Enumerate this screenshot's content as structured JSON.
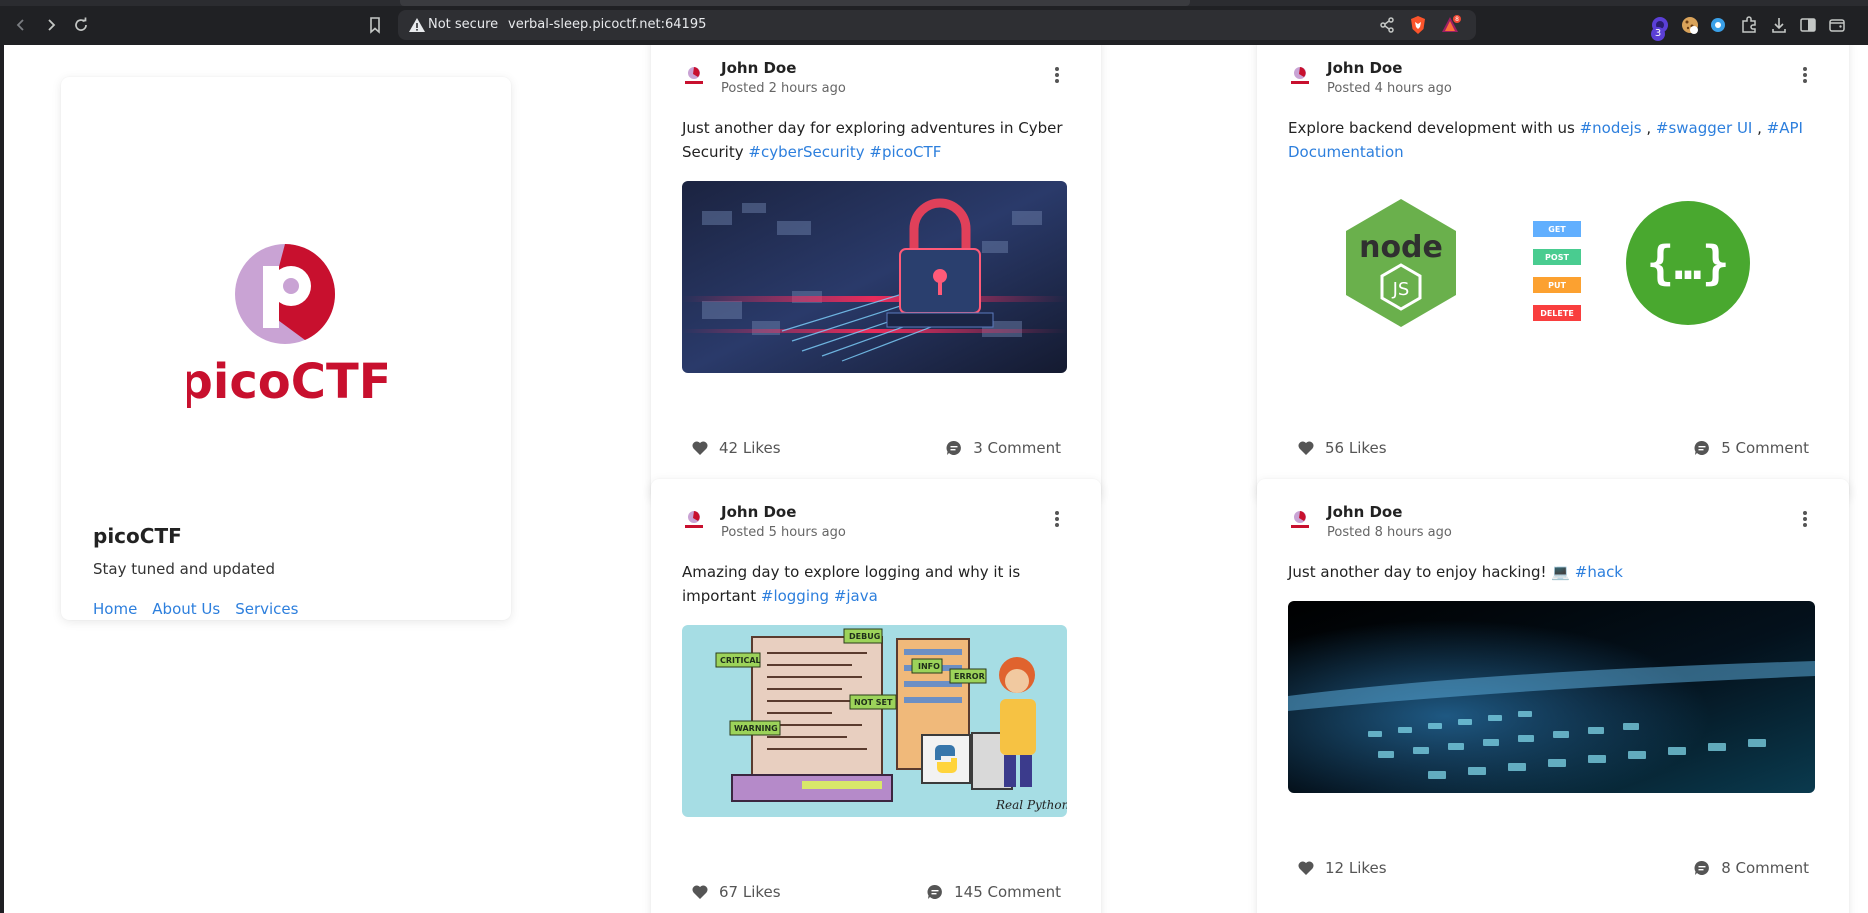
{
  "browser": {
    "security_label": "Not secure",
    "url": "verbal-sleep.picoctf.net:64195",
    "extension_badge": "3"
  },
  "profile": {
    "logo_text": "picoCTF",
    "name": "picoCTF",
    "tagline": "Stay tuned and updated",
    "links": [
      "Home",
      "About Us",
      "Services"
    ]
  },
  "posts": [
    {
      "author": "John Doe",
      "time": "Posted 2 hours ago",
      "text_parts": [
        {
          "t": "Just another day for exploring adventures in Cyber Security ",
          "h": false
        },
        {
          "t": "#cyberSecurity",
          "h": true
        },
        {
          "t": " ",
          "h": false
        },
        {
          "t": "#picoCTF",
          "h": true
        }
      ],
      "likes": "42 Likes",
      "comments": "3 Comment"
    },
    {
      "author": "John Doe",
      "time": "Posted 4 hours ago",
      "text_parts": [
        {
          "t": "Explore backend development with us ",
          "h": false
        },
        {
          "t": "#nodejs",
          "h": true
        },
        {
          "t": " , ",
          "h": false
        },
        {
          "t": "#swagger UI",
          "h": true
        },
        {
          "t": " , ",
          "h": false
        },
        {
          "t": "#API Documentation",
          "h": true
        }
      ],
      "image_labels": [
        "GET",
        "POST",
        "PUT",
        "DELETE"
      ],
      "likes": "56 Likes",
      "comments": "5 Comment"
    },
    {
      "author": "John Doe",
      "time": "Posted 5 hours ago",
      "text_parts": [
        {
          "t": "Amazing day to explore logging and why it is important ",
          "h": false
        },
        {
          "t": "#logging",
          "h": true
        },
        {
          "t": " ",
          "h": false
        },
        {
          "t": "#java",
          "h": true
        }
      ],
      "image_labels": [
        "CRITICAL",
        "DEBUG",
        "INFO",
        "ERROR",
        "NOT SET",
        "WARNING",
        "Real Python"
      ],
      "likes": "67 Likes",
      "comments": "145 Comment"
    },
    {
      "author": "John Doe",
      "time": "Posted 8 hours ago",
      "text_parts": [
        {
          "t": "Just another day to enjoy hacking! 💻 ",
          "h": false
        },
        {
          "t": "#hack",
          "h": true
        }
      ],
      "likes": "12 Likes",
      "comments": "8 Comment"
    }
  ],
  "colors": {
    "link": "#2d7fdd",
    "brand_red": "#c8102e",
    "brand_lilac": "#c9a3d4"
  }
}
